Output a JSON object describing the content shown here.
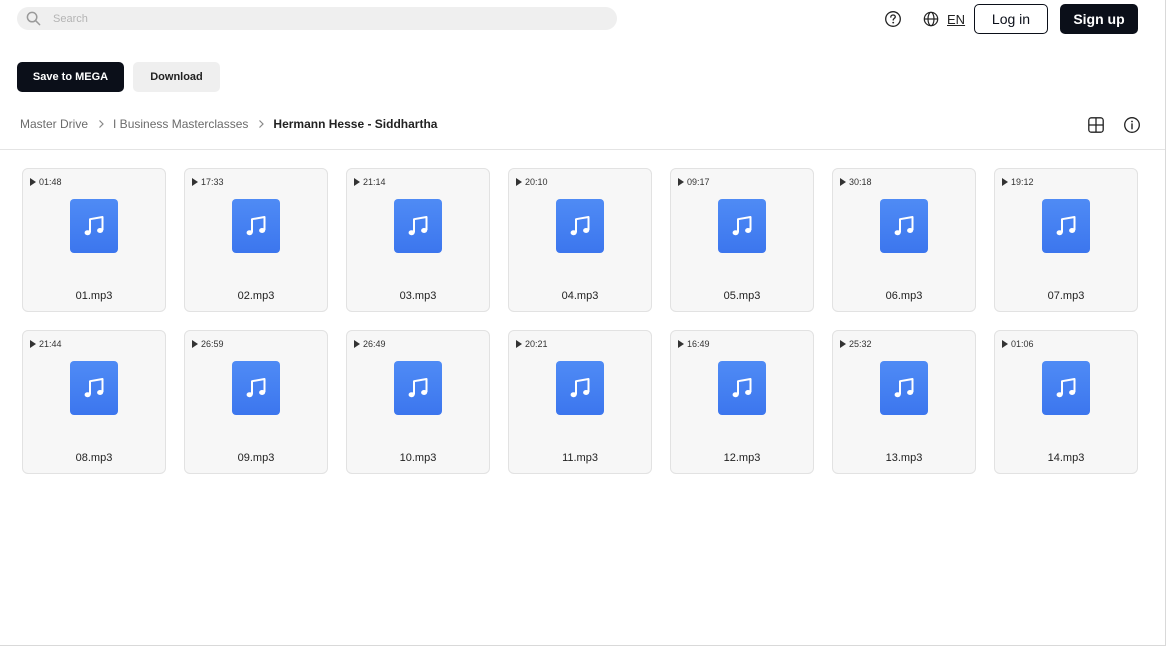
{
  "search": {
    "placeholder": "Search",
    "value": ""
  },
  "header": {
    "language": "EN",
    "login_label": "Log in",
    "signup_label": "Sign up"
  },
  "actions": {
    "save_label": "Save to MEGA",
    "download_label": "Download"
  },
  "breadcrumb": {
    "items": [
      "Master Drive",
      "I Business Masterclasses"
    ],
    "current": "Hermann Hesse - Siddhartha"
  },
  "files": [
    {
      "name": "01.mp3",
      "duration": "01:48"
    },
    {
      "name": "02.mp3",
      "duration": "17:33"
    },
    {
      "name": "03.mp3",
      "duration": "21:14"
    },
    {
      "name": "04.mp3",
      "duration": "20:10"
    },
    {
      "name": "05.mp3",
      "duration": "09:17"
    },
    {
      "name": "06.mp3",
      "duration": "30:18"
    },
    {
      "name": "07.mp3",
      "duration": "19:12"
    },
    {
      "name": "08.mp3",
      "duration": "21:44"
    },
    {
      "name": "09.mp3",
      "duration": "26:59"
    },
    {
      "name": "10.mp3",
      "duration": "26:49"
    },
    {
      "name": "11.mp3",
      "duration": "20:21"
    },
    {
      "name": "12.mp3",
      "duration": "16:49"
    },
    {
      "name": "13.mp3",
      "duration": "25:32"
    },
    {
      "name": "14.mp3",
      "duration": "01:06"
    }
  ],
  "icons": {
    "search": "search-icon",
    "help": "question-circle-icon",
    "language": "globe-icon",
    "view": "grid-view-icon",
    "info": "info-icon",
    "file": "music-note-icon",
    "play": "play-icon"
  },
  "colors": {
    "primary_dark": "#0b0f19",
    "file_icon": "#4a84f3",
    "card_bg": "#f7f7f7"
  }
}
